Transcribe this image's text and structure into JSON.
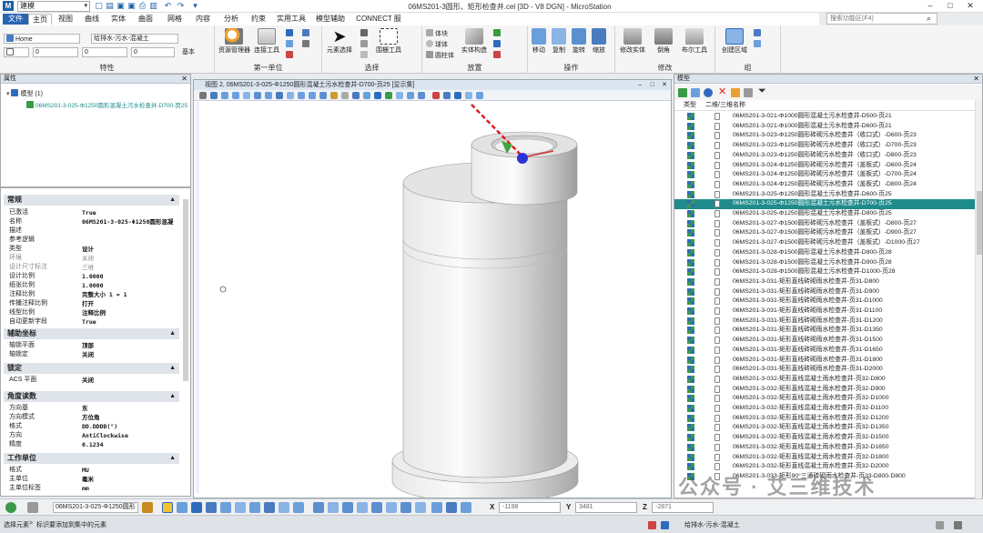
{
  "titlebar": {
    "workspace": "建模",
    "window_title": "06MS201-3圆形、矩形检查井.cel [3D - V8 DGN] - MicroStation",
    "search_placeholder": "搜索功能区(F4)"
  },
  "tabs": [
    "文件",
    "主页",
    "视图",
    "曲线",
    "实体",
    "曲面",
    "网格",
    "内容",
    "分析",
    "约束",
    "实用工具",
    "模型辅助",
    "CONNECT 服务"
  ],
  "ribbon": {
    "attributes": {
      "label": "特性",
      "level_combo": "Home",
      "material_combo": "给排水-污水-混凝土",
      "color_value": "0",
      "weight_value": "0",
      "style_value": "0",
      "basic_label": "基本"
    },
    "primary": {
      "label": "第一单位",
      "explorer": "资源管理器",
      "attach": "连接工具"
    },
    "select": {
      "label": "选择",
      "element_select": "元素选择",
      "fence": "围栅工具"
    },
    "placement": {
      "label": "放置",
      "cylinder": "体块",
      "sphere": "球体",
      "cone": "圆柱体",
      "block": "实体构造",
      "arc": "3D 工具"
    },
    "operations": {
      "label": "操作",
      "move": "移动",
      "copy": "复制",
      "rotate": "旋转",
      "scale": "缩放",
      "mirror": "镜像"
    },
    "modify": {
      "label": "修改",
      "modify_solid": "修改实体",
      "fillet": "倒角",
      "boolean": "布尔工具"
    },
    "groups": {
      "label": "组",
      "create_region": "创建区域"
    }
  },
  "left_top": {
    "header": "属性",
    "tree": [
      "模型 (1)",
      "06MS201-3-025-Φ1250圆形混凝土污水检查井-D700-页25"
    ]
  },
  "properties": {
    "general": {
      "title": "常规",
      "rows": [
        [
          "已激活",
          "True"
        ],
        [
          "名称",
          "06MS201-3-025-Φ1250圆形混凝"
        ],
        [
          "描述",
          ""
        ],
        [
          "参考逻辑",
          ""
        ],
        [
          "类型",
          "设计"
        ],
        [
          "环境",
          "关闭"
        ],
        [
          "设计尺寸标注",
          "三维"
        ],
        [
          "设计比例",
          "1.0000"
        ],
        [
          "纸张比例",
          "1.0000"
        ],
        [
          "注释比例",
          "完整大小 1 = 1"
        ],
        [
          "传播注释比例",
          "打开"
        ],
        [
          "线型比例",
          "注释比例"
        ],
        [
          "自动更新字段",
          "True"
        ]
      ]
    },
    "grid": {
      "title": "辅助坐标",
      "rows": [
        [
          "轴锁平面",
          "顶部"
        ],
        [
          "轴锁定",
          "关闭"
        ]
      ]
    },
    "lock": {
      "title": "锁定",
      "rows": [
        [
          "ACS 平面",
          "关闭"
        ]
      ]
    },
    "angle": {
      "title": "角度读数",
      "rows": [
        [
          "方向基",
          "东"
        ],
        [
          "方向模式",
          "方位角"
        ],
        [
          "格式",
          "DD.DDDD(°)"
        ],
        [
          "方向",
          "AntiClockwise"
        ],
        [
          "精度",
          "0.1234"
        ]
      ]
    },
    "units": {
      "title": "工作单位",
      "rows": [
        [
          "格式",
          "MU"
        ],
        [
          "主单位",
          "毫米"
        ],
        [
          "主单位标签",
          "mm"
        ]
      ]
    }
  },
  "view": {
    "title": "视图 2, 06MS201-3-025-Φ1250圆形混凝土污水检查井-D700-页25 [显示集]"
  },
  "models_panel": {
    "header": "模型",
    "columns": [
      "类型",
      "二维/三维",
      "名称"
    ],
    "selected_index": 9,
    "rows": [
      "06MS201-3-021-Φ1000圆形混凝土污水检查井-D500-页21",
      "06MS201-3-021-Φ1000圆形混凝土污水检查井-D600-页21",
      "06MS201-3-023-Φ1250圆形砖砌污水检查井（收口式）-D600-页23",
      "06MS201-3-023-Φ1250圆形砖砌污水检查井（收口式）-D700-页23",
      "06MS201-3-023-Φ1250圆形砖砌污水检查井（收口式）-D800-页23",
      "06MS201-3-024-Φ1250圆形砖砌污水检查井（盖板式）-D600-页24",
      "06MS201-3-024-Φ1250圆形砖砌污水检查井（盖板式）-D700-页24",
      "06MS201-3-024-Φ1250圆形砖砌污水检查井（盖板式）-D800-页24",
      "06MS201-3-025-Φ1250圆形混凝土污水检查井-D600-页25",
      "06MS201-3-025-Φ1250圆形混凝土污水检查井-D700-页25",
      "06MS201-3-025-Φ1250圆形混凝土污水检查井-D800-页25",
      "06MS201-3-027-Φ1500圆形砖砌污水检查井（盖板式）-D800-页27",
      "06MS201-3-027-Φ1500圆形砖砌污水检查井（盖板式）-D900-页27",
      "06MS201-3-027-Φ1500圆形砖砌污水检查井（盖板式）-D1000-页27",
      "06MS201-3-028-Φ1500圆形混凝土污水检查井-D800-页28",
      "06MS201-3-028-Φ1500圆形混凝土污水检查井-D900-页28",
      "06MS201-3-028-Φ1500圆形混凝土污水检查井-D1000-页28",
      "06MS201-3-031-矩形直线砖砌雨水检查井-页31-D800",
      "06MS201-3-031-矩形直线砖砌雨水检查井-页31-D900",
      "06MS201-3-031-矩形直线砖砌雨水检查井-页31-D1000",
      "06MS201-3-031-矩形直线砖砌雨水检查井-页31-D1100",
      "06MS201-3-031-矩形直线砖砌雨水检查井-页31-D1200",
      "06MS201-3-031-矩形直线砖砌雨水检查井-页31-D1350",
      "06MS201-3-031-矩形直线砖砌雨水检查井-页31-D1500",
      "06MS201-3-031-矩形直线砖砌雨水检查井-页31-D1650",
      "06MS201-3-031-矩形直线砖砌雨水检查井-页31-D1800",
      "06MS201-3-031-矩形直线砖砌雨水检查井-页31-D2000",
      "06MS201-3-032-矩形直线混凝土雨水检查井-页32-D800",
      "06MS201-3-032-矩形直线混凝土雨水检查井-页32-D900",
      "06MS201-3-032-矩形直线混凝土雨水检查井-页32-D1000",
      "06MS201-3-032-矩形直线混凝土雨水检查井-页32-D1100",
      "06MS201-3-032-矩形直线混凝土雨水检查井-页32-D1200",
      "06MS201-3-032-矩形直线混凝土雨水检查井-页32-D1350",
      "06MS201-3-032-矩形直线混凝土雨水检查井-页32-D1500",
      "06MS201-3-032-矩形直线混凝土雨水检查井-页32-D1650",
      "06MS201-3-032-矩形直线混凝土雨水检查井-页32-D1800",
      "06MS201-3-032-矩形直线混凝土雨水检查井-页32-D2000",
      "06MS201-3-033-矩形90°三通砖砌雨水检查井-页33-D800-D800"
    ]
  },
  "bottombar": {
    "model_combo": "06MS201-3-025-Φ1250圆形",
    "x_label": "X",
    "x_value": "-1198",
    "y_label": "Y",
    "y_value": "3481",
    "z_label": "Z",
    "z_value": "-2871"
  },
  "statusbar": {
    "prompt": "选择元素",
    "message": "标识要添加到集中的元素",
    "right_item": "给排水-污水-混凝土"
  },
  "watermark": "公众号 · 艾三维技术",
  "colors": {
    "selected_row": "#1f8b8b",
    "file_tab": "#2866b2",
    "type_icon_blue": "#2f6bbd",
    "type_icon_green": "#3a9a46"
  }
}
